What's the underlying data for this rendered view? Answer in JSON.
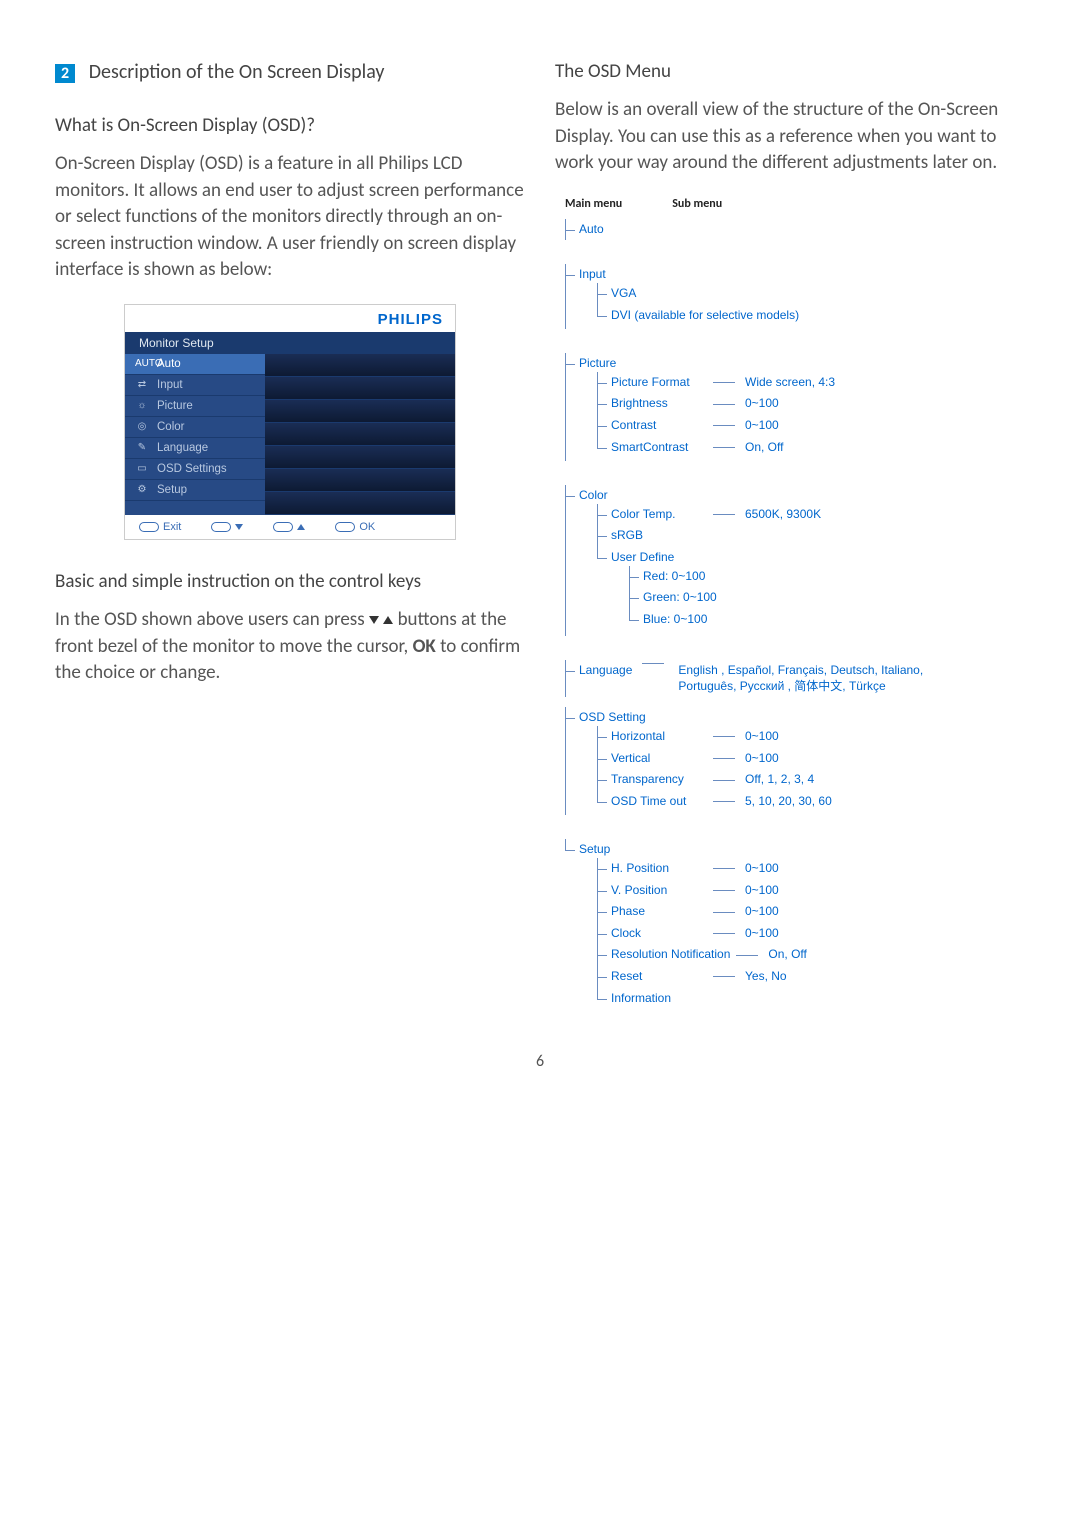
{
  "section_number": "2",
  "section_title": "Description of the On Screen Display",
  "left": {
    "q_title": "What is On-Screen Display (OSD)?",
    "q_body": "On-Screen Display (OSD) is a feature in all Philips LCD monitors. It allows an end user to adjust screen performance or select functions of the monitors directly through an on-screen instruction window. A user friendly on screen display interface is shown as below:",
    "osd_brand": "PHILIPS",
    "osd_title": "Monitor Setup",
    "osd_menu": [
      {
        "icon": "AUTO",
        "label": "Auto",
        "active": true
      },
      {
        "icon": "⇄",
        "label": "Input"
      },
      {
        "icon": "☼",
        "label": "Picture"
      },
      {
        "icon": "◎",
        "label": "Color"
      },
      {
        "icon": "✎",
        "label": "Language"
      },
      {
        "icon": "▭",
        "label": "OSD Settings"
      },
      {
        "icon": "⚙",
        "label": "Setup"
      }
    ],
    "osd_footer": {
      "exit": "Exit",
      "ok": "OK"
    },
    "instr_title": "Basic and simple instruction on the control keys",
    "instr_body_1": "In the OSD shown above users can press ",
    "instr_body_2": " buttons at the front bezel of the monitor to move the cursor, ",
    "instr_ok": "OK",
    "instr_body_3": " to confirm the choice or change."
  },
  "right": {
    "title": "The OSD Menu",
    "body": "Below is an overall view of the structure of the On-Screen Display. You can use this as a reference when you want to work your way around the different adjustments later on.",
    "head_main": "Main menu",
    "head_sub": "Sub menu",
    "tree": {
      "auto": "Auto",
      "input": {
        "label": "Input",
        "children": [
          {
            "label": "VGA"
          },
          {
            "label": "DVI (available for selective models)"
          }
        ]
      },
      "picture": {
        "label": "Picture",
        "children": [
          {
            "label": "Picture Format",
            "val": "Wide screen, 4:3"
          },
          {
            "label": "Brightness",
            "val": "0~100"
          },
          {
            "label": "Contrast",
            "val": "0~100"
          },
          {
            "label": "SmartContrast",
            "val": "On, Off"
          }
        ]
      },
      "color": {
        "label": "Color",
        "children": [
          {
            "label": "Color Temp.",
            "val": "6500K, 9300K"
          },
          {
            "label": "sRGB"
          },
          {
            "label": "User Define",
            "children": [
              {
                "label": "Red: 0~100"
              },
              {
                "label": "Green: 0~100"
              },
              {
                "label": "Blue: 0~100"
              }
            ]
          }
        ]
      },
      "language": {
        "label": "Language",
        "val": "English , Español, Français, Deutsch, Italiano, Português, Русский , 简体中文, Türkçe"
      },
      "osd_setting": {
        "label": "OSD Setting",
        "children": [
          {
            "label": "Horizontal",
            "val": "0~100"
          },
          {
            "label": "Vertical",
            "val": "0~100"
          },
          {
            "label": "Transparency",
            "val": "Off, 1, 2, 3, 4"
          },
          {
            "label": "OSD Time out",
            "val": "5, 10, 20, 30, 60"
          }
        ]
      },
      "setup": {
        "label": "Setup",
        "children": [
          {
            "label": "H. Position",
            "val": "0~100"
          },
          {
            "label": "V. Position",
            "val": "0~100"
          },
          {
            "label": "Phase",
            "val": "0~100"
          },
          {
            "label": "Clock",
            "val": "0~100"
          },
          {
            "label": "Resolution Notification",
            "val": "On, Off"
          },
          {
            "label": "Reset",
            "val": "Yes, No"
          },
          {
            "label": "Information"
          }
        ]
      }
    }
  },
  "page_number": "6"
}
